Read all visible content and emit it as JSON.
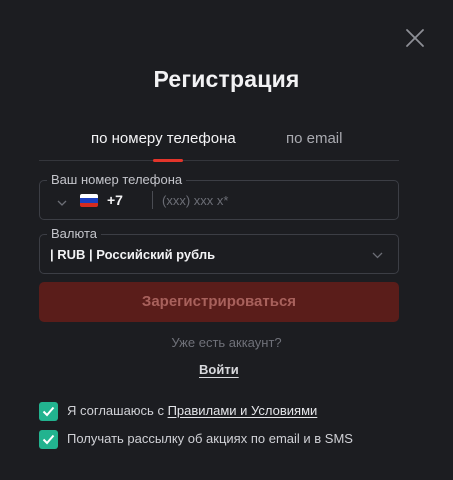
{
  "dialog": {
    "title": "Регистрация"
  },
  "tabs": [
    {
      "label": "по номеру телефона",
      "active": true
    },
    {
      "label": "по email",
      "active": false
    }
  ],
  "phone": {
    "legend": "Ваш номер телефона",
    "country_flag": "ru-flag-icon",
    "dial_code": "+7",
    "placeholder": "(xxx) xxx x*",
    "value": ""
  },
  "currency": {
    "legend": "Валюта",
    "selected": "| RUB | Российский рубль"
  },
  "register_button": {
    "label": "Зарегистрироваться"
  },
  "login": {
    "prompt": "Уже есть аккаунт?",
    "link_label": "Войти"
  },
  "consents": [
    {
      "prefix": "Я соглашаюсь с ",
      "link_text": "Правилами и Условиями",
      "checked": true
    },
    {
      "text": "Получать рассылку об акциях по email и в SMS",
      "checked": true
    }
  ],
  "colors": {
    "background": "#1c1d21",
    "accent_red": "#e3352b",
    "button_disabled": "#5a1d1a",
    "checkbox_green": "#22b38f"
  }
}
